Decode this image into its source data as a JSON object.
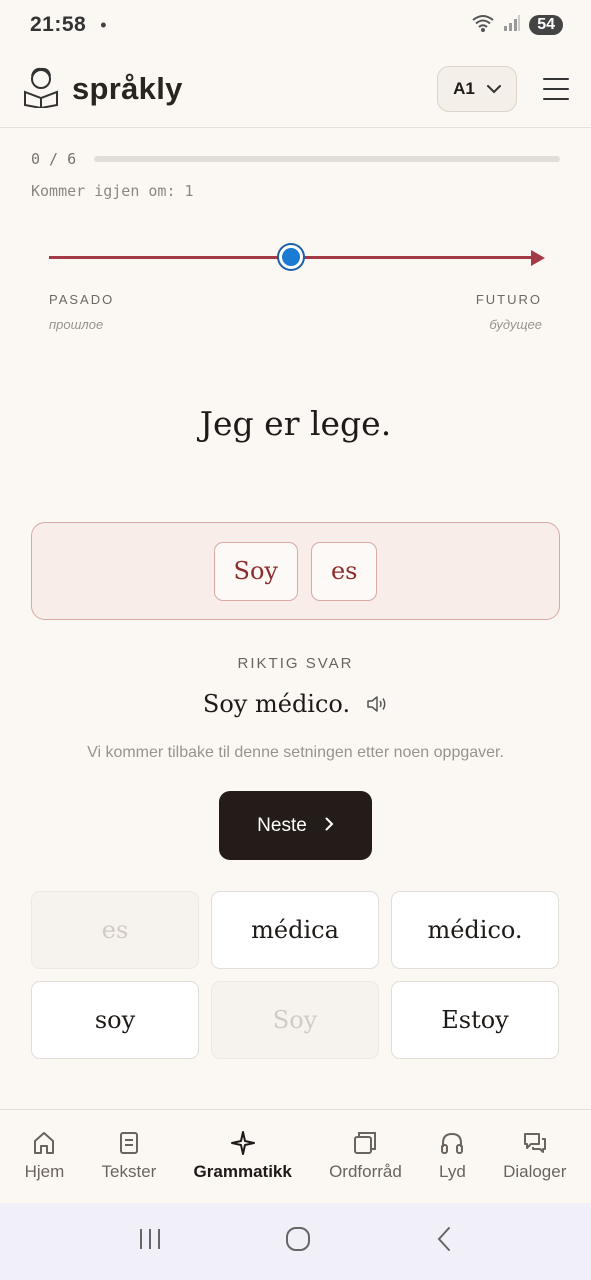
{
  "status_bar": {
    "time": "21:58",
    "dot": "•",
    "battery": "54"
  },
  "header": {
    "app_name": "språkly",
    "level": "A1"
  },
  "progress": {
    "count": "0 / 6",
    "fraction": 0,
    "repeat_note": "Kommer igjen om: 1"
  },
  "timeline": {
    "marker_position": 0.5,
    "left_label": "PASADO",
    "left_sub": "прошлое",
    "right_label": "FUTURO",
    "right_sub": "будущее"
  },
  "exercise": {
    "sentence": "Jeg er lege.",
    "answer_chips": [
      "Soy",
      "es"
    ],
    "correct_label": "RIKTIG SVAR",
    "correct_answer": "Soy médico.",
    "return_note": "Vi kommer tilbake til denne setningen etter noen oppgaver.",
    "next_label": "Neste"
  },
  "word_bank": [
    {
      "text": "es",
      "used": true
    },
    {
      "text": "médica",
      "used": false
    },
    {
      "text": "médico.",
      "used": false
    },
    {
      "text": "soy",
      "used": false
    },
    {
      "text": "Soy",
      "used": true
    },
    {
      "text": "Estoy",
      "used": false
    }
  ],
  "nav": {
    "items": [
      {
        "label": "Hjem",
        "icon": "home-icon"
      },
      {
        "label": "Tekster",
        "icon": "document-icon"
      },
      {
        "label": "Grammatikk",
        "icon": "sparkle-icon",
        "active": true
      },
      {
        "label": "Ordforråd",
        "icon": "cards-icon"
      },
      {
        "label": "Lyd",
        "icon": "headphones-icon"
      },
      {
        "label": "Dialoger",
        "icon": "chat-icon"
      }
    ]
  },
  "colors": {
    "accent": "#a53a47",
    "marker": "#1a7ad4",
    "button": "#231c18",
    "background": "#fbf8f4"
  }
}
